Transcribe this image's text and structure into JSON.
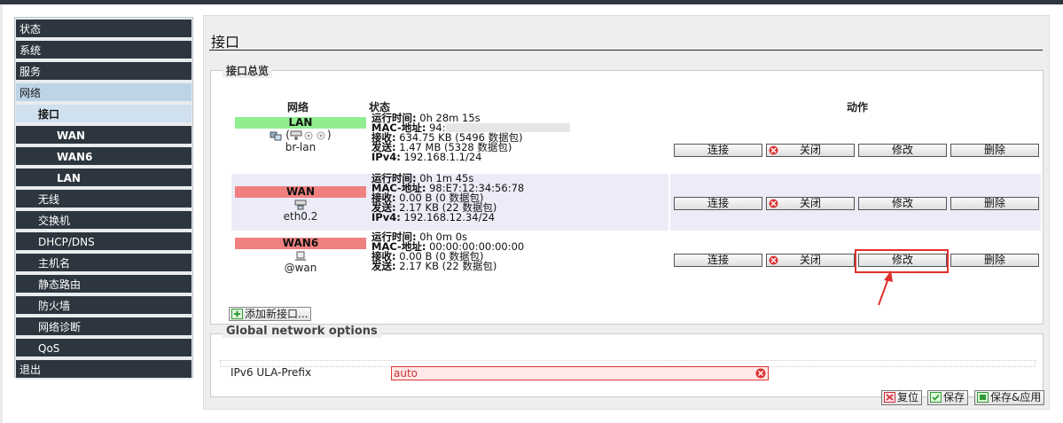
{
  "sidebar": {
    "items": [
      {
        "label": "状态"
      },
      {
        "label": "系统"
      },
      {
        "label": "服务"
      },
      {
        "label": "网络"
      },
      {
        "label": "接口"
      },
      {
        "label": "WAN"
      },
      {
        "label": "WAN6"
      },
      {
        "label": "LAN"
      },
      {
        "label": "无线"
      },
      {
        "label": "交换机"
      },
      {
        "label": "DHCP/DNS"
      },
      {
        "label": "主机名"
      },
      {
        "label": "静态路由"
      },
      {
        "label": "防火墙"
      },
      {
        "label": "网络诊断"
      },
      {
        "label": "QoS"
      },
      {
        "label": "退出"
      }
    ]
  },
  "page": {
    "title": "接口"
  },
  "overview": {
    "legend": "接口总览",
    "headers": {
      "network": "网络",
      "status": "状态",
      "actions": "动作"
    },
    "interfaces": [
      {
        "name": "LAN",
        "color": "#90ee90",
        "devices": "(",
        "devices_end": ")",
        "ifname": "br-lan",
        "uptime_label": "运行时间:",
        "uptime": "0h 28m 15s",
        "mac_label": "MAC-地址:",
        "mac": "94:",
        "rx_label": "接收:",
        "rx": "634.75 KB (5496 数据包)",
        "tx_label": "发送:",
        "tx": "1.47 MB (5328 数据包)",
        "ipv4_label": "IPv4:",
        "ipv4": "192.168.1.1/24"
      },
      {
        "name": "WAN",
        "color": "#f08080",
        "ifname": "eth0.2",
        "uptime_label": "运行时间:",
        "uptime": "0h 1m 45s",
        "mac_label": "MAC-地址:",
        "mac": "98:E7:12:34:56:78",
        "rx_label": "接收:",
        "rx": "0.00 B (0 数据包)",
        "tx_label": "发送:",
        "tx": "2.17 KB (22 数据包)",
        "ipv4_label": "IPv4:",
        "ipv4": "192.168.12.34/24"
      },
      {
        "name": "WAN6",
        "color": "#f08080",
        "ifname": "@wan",
        "uptime_label": "运行时间:",
        "uptime": "0h 0m 0s",
        "mac_label": "MAC-地址:",
        "mac": "00:00:00:00:00:00",
        "rx_label": "接收:",
        "rx": "0.00 B (0 数据包)",
        "tx_label": "发送:",
        "tx": "2.17 KB (22 数据包)"
      }
    ],
    "buttons": {
      "connect": "连接",
      "close": "关闭",
      "edit": "修改",
      "delete": "删除"
    },
    "add_button": "添加新接口..."
  },
  "global": {
    "legend": "Global network options",
    "ula_label": "IPv6 ULA-Prefix",
    "ula_value": "auto"
  },
  "footer": {
    "reset": "复位",
    "save": "保存",
    "save_apply": "保存&应用"
  },
  "colors": {
    "sidebar_bg": "#2d363e",
    "sidebar_active": "#bcd4e6",
    "up_badge": "#90ee90",
    "down_badge": "#f08080",
    "highlight": "#e0302c"
  }
}
